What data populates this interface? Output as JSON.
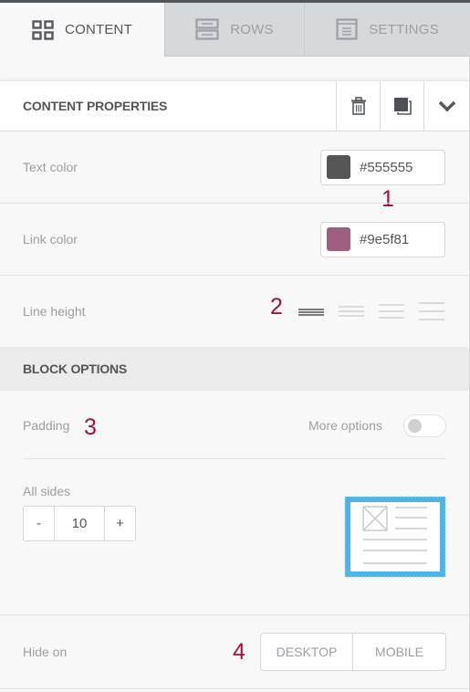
{
  "tabs": [
    {
      "label": "CONTENT",
      "icon": "grid-icon",
      "active": true
    },
    {
      "label": "ROWS",
      "icon": "rows-icon",
      "active": false
    },
    {
      "label": "SETTINGS",
      "icon": "settings-doc-icon",
      "active": false
    }
  ],
  "panel": {
    "title": "CONTENT PROPERTIES",
    "actions": [
      {
        "name": "delete",
        "icon": "trash-icon"
      },
      {
        "name": "duplicate",
        "icon": "duplicate-icon"
      },
      {
        "name": "collapse",
        "icon": "chevron-down-icon"
      }
    ]
  },
  "content_properties": {
    "text_color": {
      "label": "Text color",
      "value": "#555555",
      "swatch": "#555555"
    },
    "link_color": {
      "label": "Link color",
      "value": "#9e5f81",
      "swatch": "#9e5f81"
    },
    "line_height": {
      "label": "Line height",
      "options": [
        "compact",
        "normal",
        "relaxed",
        "loose"
      ],
      "selected": 0
    }
  },
  "block_options": {
    "title": "BLOCK OPTIONS",
    "padding": {
      "label": "Padding",
      "more_options_label": "More options",
      "more_options_enabled": false,
      "all_sides_label": "All sides",
      "value": "10",
      "decrement_label": "-",
      "increment_label": "+"
    },
    "hide_on": {
      "label": "Hide on",
      "options": [
        "DESKTOP",
        "MOBILE"
      ]
    }
  },
  "annotations": [
    "1",
    "2",
    "3",
    "4"
  ],
  "colors": {
    "accent_preview": "#4db5e6",
    "annotation": "#a0123a"
  }
}
